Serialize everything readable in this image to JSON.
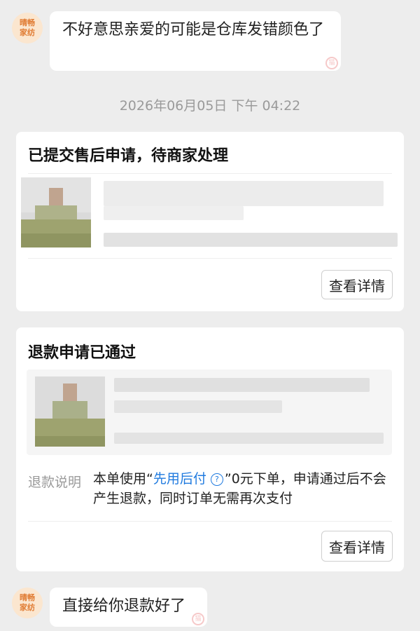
{
  "avatar": {
    "line1": "晴畅",
    "line2": "家纺"
  },
  "messages": {
    "first": "不好意思亲爱的可能是仓库发错颜色了",
    "last": "直接给你退款好了"
  },
  "timestamp": "2026年06月05日 下午 04:22",
  "card1": {
    "title": "已提交售后申请，待商家处理",
    "button": "查看详情"
  },
  "card2": {
    "title": "退款申请已通过",
    "explain_label": "退款说明",
    "explain_prefix": "本单使用“",
    "explain_link": "先用后付",
    "explain_suffix": "”0元下单，申请通过后不会产生退款，同时订单无需再次支付",
    "button": "查看详情"
  },
  "icons": {
    "help": "question-circle-icon",
    "watermark": "logo-watermark-icon"
  }
}
